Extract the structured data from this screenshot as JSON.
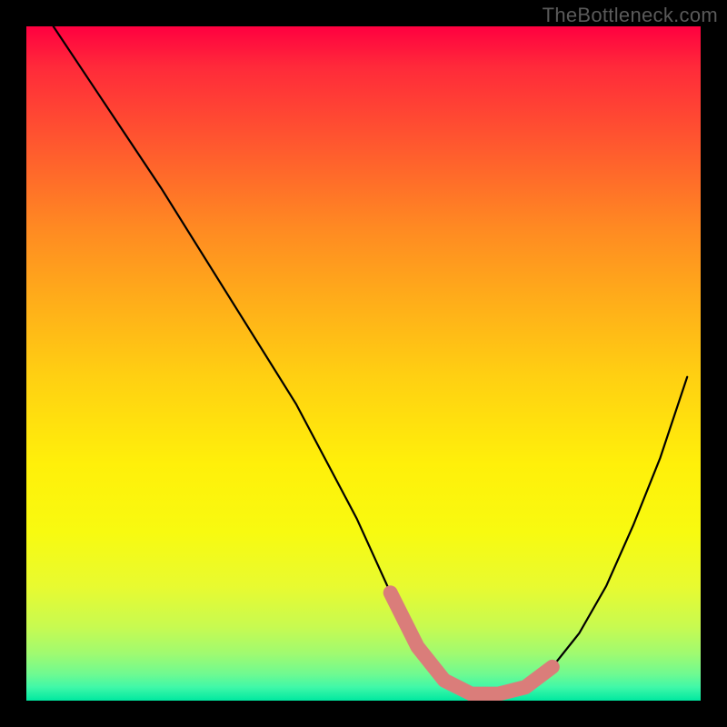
{
  "watermark": "TheBottleneck.com",
  "colors": {
    "black": "#000000",
    "curve": "#000000",
    "highlight": "#da7d7a"
  },
  "chart_data": {
    "type": "line",
    "title": "",
    "xlabel": "",
    "ylabel": "",
    "xlim": [
      0,
      100
    ],
    "ylim": [
      0,
      100
    ],
    "series": [
      {
        "name": "bottleneck-curve",
        "x": [
          4,
          10,
          20,
          30,
          40,
          49,
          54,
          58,
          62,
          66,
          70,
          74,
          78,
          82,
          86,
          90,
          94,
          98
        ],
        "values": [
          100,
          91,
          76,
          60,
          44,
          27,
          16,
          8,
          3,
          1,
          1,
          2,
          5,
          10,
          17,
          26,
          36,
          48
        ]
      }
    ],
    "highlight_region": {
      "name": "optimal-range",
      "x": [
        54,
        58,
        62,
        66,
        70,
        74,
        78
      ],
      "values": [
        16,
        8,
        3,
        1,
        1,
        2,
        5
      ]
    },
    "gradient_stops": [
      {
        "pct": 0,
        "color": "#ff0040"
      },
      {
        "pct": 30,
        "color": "#ff8a22"
      },
      {
        "pct": 65,
        "color": "#fff00a"
      },
      {
        "pct": 100,
        "color": "#00e8a0"
      }
    ]
  }
}
